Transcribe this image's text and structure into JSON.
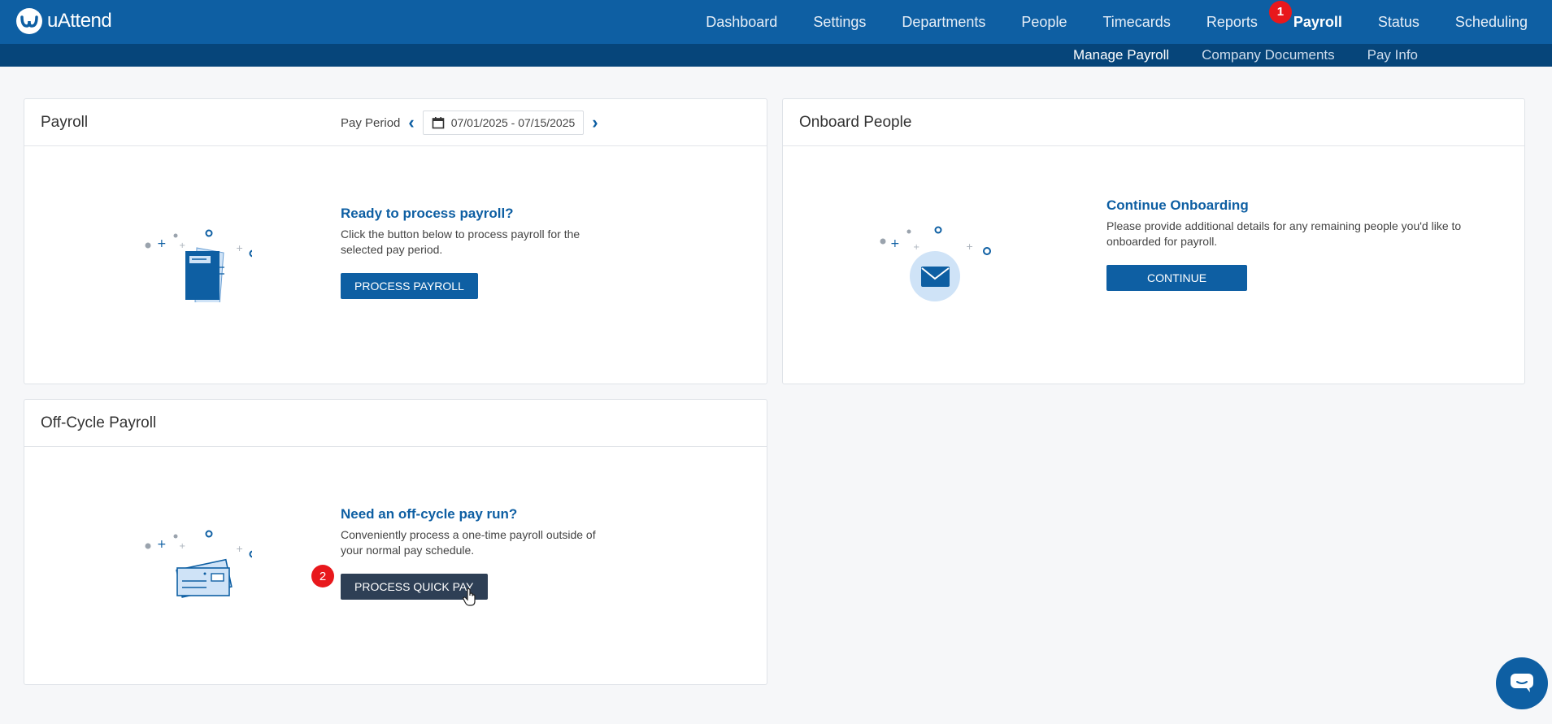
{
  "brand": {
    "name": "uAttend"
  },
  "nav": {
    "items": [
      "Dashboard",
      "Settings",
      "Departments",
      "People",
      "Timecards",
      "Reports",
      "Payroll",
      "Status",
      "Scheduling"
    ],
    "active": "Payroll"
  },
  "subnav": {
    "items": [
      "Manage Payroll",
      "Company Documents",
      "Pay Info"
    ],
    "active": "Manage Payroll"
  },
  "steps": {
    "step1": "1",
    "step2": "2"
  },
  "payroll_card": {
    "title": "Payroll",
    "pay_period_label": "Pay Period",
    "date_range": "07/01/2025 - 07/15/2025",
    "heading": "Ready to process payroll?",
    "description": "Click the button below to process payroll for the selected pay period.",
    "button": "PROCESS PAYROLL"
  },
  "onboard_card": {
    "title": "Onboard People",
    "heading": "Continue Onboarding",
    "description": "Please provide additional details for any remaining people you'd like to onboarded for payroll.",
    "button": "CONTINUE"
  },
  "offcycle_card": {
    "title": "Off-Cycle Payroll",
    "heading": "Need an off-cycle pay run?",
    "description": "Conveniently process a one-time payroll outside of your normal pay schedule.",
    "button": "PROCESS QUICK PAY"
  },
  "icons": [
    "calendar-icon",
    "chevron-left-icon",
    "chevron-right-icon",
    "envelope-icon",
    "document-check-icon",
    "paycheck-icon",
    "chat-icon",
    "cursor-hand-icon"
  ],
  "colors": {
    "primary": "#0e5fa3",
    "subnav": "#06457a",
    "badge": "#e8181c",
    "quickpay_button": "#2e3f55"
  }
}
